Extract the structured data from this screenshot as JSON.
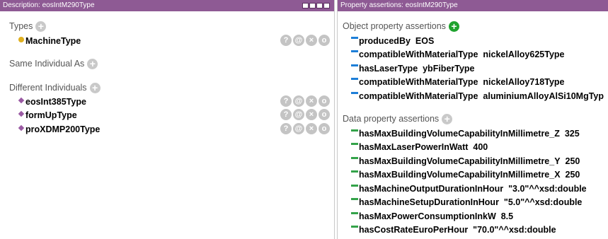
{
  "left": {
    "header": "Description: eosIntM290Type",
    "types_title": "Types",
    "types": [
      "MachineType"
    ],
    "same_title": "Same Individual As",
    "different_title": "Different Individuals",
    "different": [
      "eosInt385Type",
      "formUpType",
      "proXDMP200Type"
    ]
  },
  "right": {
    "header": "Property assertions: eosIntM290Type",
    "object_title": "Object property assertions",
    "object_props": [
      {
        "prop": "producedBy",
        "value": "EOS"
      },
      {
        "prop": "compatibleWithMaterialType",
        "value": "nickelAlloy625Type"
      },
      {
        "prop": "hasLaserType",
        "value": "ybFiberType"
      },
      {
        "prop": "compatibleWithMaterialType",
        "value": "nickelAlloy718Type"
      },
      {
        "prop": "compatibleWithMaterialType",
        "value": "aluminiumAlloyAlSi10MgTyp"
      }
    ],
    "data_title": "Data property assertions",
    "data_props": [
      {
        "prop": "hasMaxBuildingVolumeCapabilityInMillimetre_Z",
        "value": "325"
      },
      {
        "prop": "hasMaxLaserPowerInWatt",
        "value": "400"
      },
      {
        "prop": "hasMaxBuildingVolumeCapabilityInMillimetre_Y",
        "value": "250"
      },
      {
        "prop": "hasMaxBuildingVolumeCapabilityInMillimetre_X",
        "value": "250"
      },
      {
        "prop": "hasMachineOutputDurationInHour",
        "value": "\"3.0\"^^xsd:double"
      },
      {
        "prop": "hasMachineSetupDurationInHour",
        "value": "\"5.0\"^^xsd:double"
      },
      {
        "prop": "hasMaxPowerConsumptionInkW",
        "value": "8.5"
      },
      {
        "prop": "hasCostRateEuroPerHour",
        "value": "\"70.0\"^^xsd:double"
      }
    ]
  },
  "buttons": {
    "add": "+",
    "help": "?",
    "annotate": "@",
    "delete": "×",
    "edit": "o"
  }
}
